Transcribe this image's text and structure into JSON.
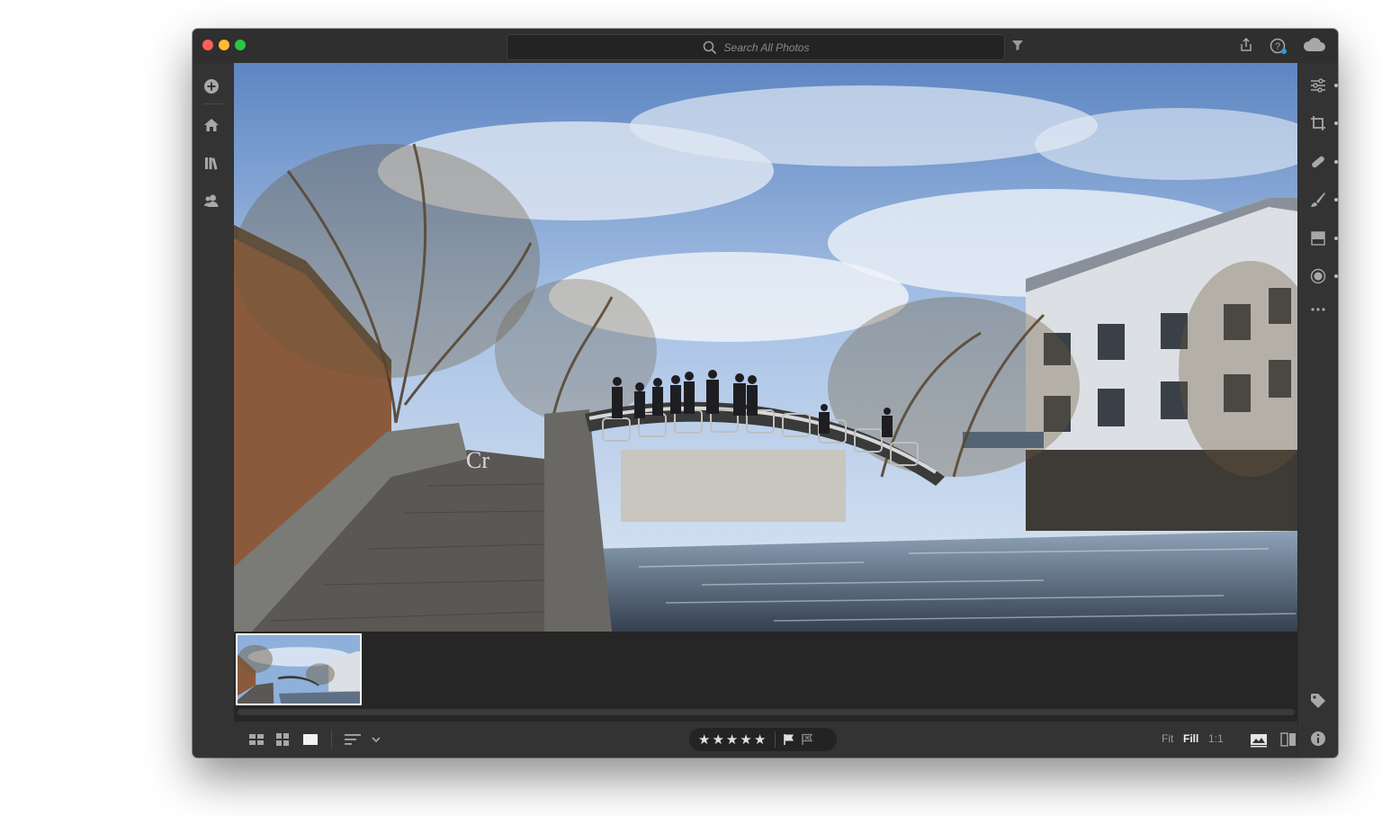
{
  "search": {
    "placeholder": "Search All Photos"
  },
  "photo": {
    "description_icon": "photo-canal-bridge"
  },
  "ratings": {
    "stars": [
      "★",
      "★",
      "★",
      "★",
      "★"
    ]
  },
  "zoom": {
    "fit": "Fit",
    "fill": "Fill",
    "one_to_one": "1:1"
  },
  "colors": {
    "app_bg": "#333333",
    "titlebar": "#2f2f2f",
    "filmstrip": "#262626",
    "accent_badge": "#2d9cdb"
  }
}
